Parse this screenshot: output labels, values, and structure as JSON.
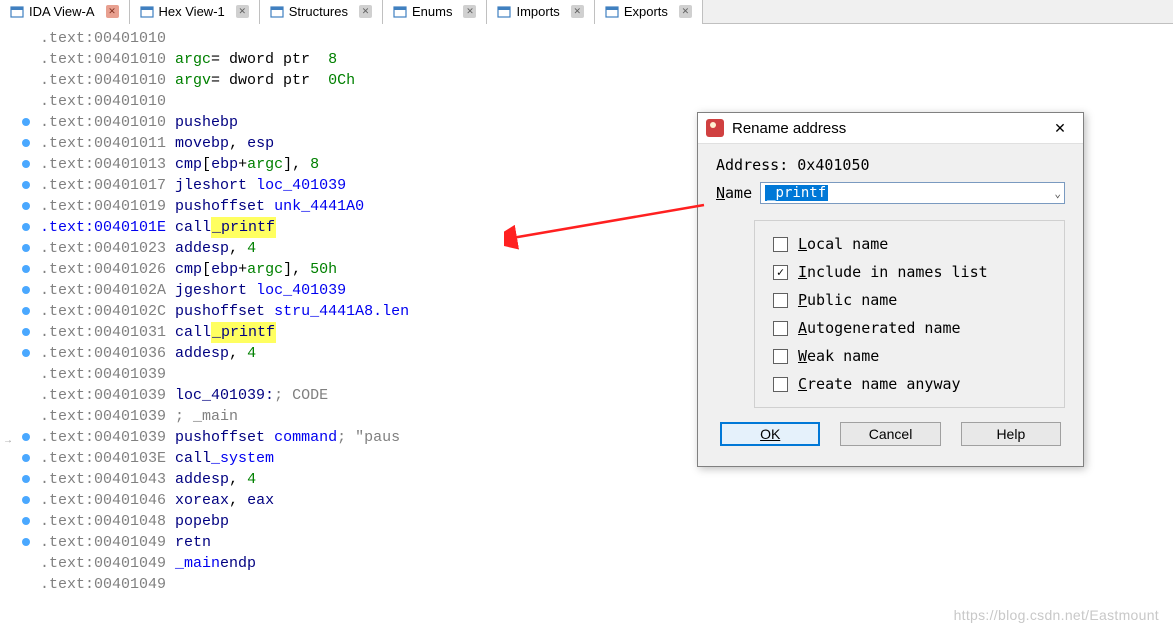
{
  "tabs": [
    {
      "label": "IDA View-A",
      "active": true,
      "closeGray": false
    },
    {
      "label": "Hex View-1",
      "active": false,
      "closeGray": true
    },
    {
      "label": "Structures",
      "active": false,
      "closeGray": true
    },
    {
      "label": "Enums",
      "active": false,
      "closeGray": true
    },
    {
      "label": "Imports",
      "active": false,
      "closeGray": true
    },
    {
      "label": "Exports",
      "active": false,
      "closeGray": true
    }
  ],
  "lines": [
    {
      "dot": false,
      "addr": ".text:00401010"
    },
    {
      "dot": false,
      "addr": ".text:00401010",
      "local": "argc",
      "eq": "= dword ptr  ",
      "eqnum": "8"
    },
    {
      "dot": false,
      "addr": ".text:00401010",
      "local": "argv",
      "eq": "= dword ptr  ",
      "eqnum": "0Ch"
    },
    {
      "dot": false,
      "addr": ".text:00401010"
    },
    {
      "dot": true,
      "addr": ".text:00401010",
      "mnem": "push",
      "ops": [
        {
          "t": "reg",
          "v": "ebp"
        }
      ]
    },
    {
      "dot": true,
      "addr": ".text:00401011",
      "mnem": "mov",
      "ops": [
        {
          "t": "reg",
          "v": "ebp"
        },
        {
          "t": "txt",
          "v": ", "
        },
        {
          "t": "reg",
          "v": "esp"
        }
      ]
    },
    {
      "dot": true,
      "addr": ".text:00401013",
      "mnem": "cmp",
      "ops": [
        {
          "t": "txt",
          "v": "["
        },
        {
          "t": "reg",
          "v": "ebp"
        },
        {
          "t": "txt",
          "v": "+"
        },
        {
          "t": "local",
          "v": "argc"
        },
        {
          "t": "txt",
          "v": "], "
        },
        {
          "t": "num",
          "v": "8"
        }
      ]
    },
    {
      "dot": true,
      "addr": ".text:00401017",
      "mnem": "jle",
      "ops": [
        {
          "t": "mnem",
          "v": "short "
        },
        {
          "t": "ident",
          "v": "loc_401039"
        }
      ]
    },
    {
      "dot": true,
      "addr": ".text:00401019",
      "mnem": "push",
      "ops": [
        {
          "t": "mnem",
          "v": "offset "
        },
        {
          "t": "ident",
          "v": "unk_4441A0"
        }
      ]
    },
    {
      "dot": true,
      "addr": ".text:0040101E",
      "addrBlue": true,
      "mnem": "call",
      "ops": [
        {
          "t": "hl",
          "v": "_printf"
        }
      ]
    },
    {
      "dot": true,
      "addr": ".text:00401023",
      "mnem": "add",
      "ops": [
        {
          "t": "reg",
          "v": "esp"
        },
        {
          "t": "txt",
          "v": ", "
        },
        {
          "t": "num",
          "v": "4"
        }
      ]
    },
    {
      "dot": true,
      "addr": ".text:00401026",
      "mnem": "cmp",
      "ops": [
        {
          "t": "txt",
          "v": "["
        },
        {
          "t": "reg",
          "v": "ebp"
        },
        {
          "t": "txt",
          "v": "+"
        },
        {
          "t": "local",
          "v": "argc"
        },
        {
          "t": "txt",
          "v": "], "
        },
        {
          "t": "num",
          "v": "50h"
        }
      ]
    },
    {
      "dot": true,
      "addr": ".text:0040102A",
      "mnem": "jge",
      "ops": [
        {
          "t": "mnem",
          "v": "short "
        },
        {
          "t": "ident",
          "v": "loc_401039"
        }
      ]
    },
    {
      "dot": true,
      "addr": ".text:0040102C",
      "mnem": "push",
      "ops": [
        {
          "t": "mnem",
          "v": "offset "
        },
        {
          "t": "ident",
          "v": "stru_4441A8.len"
        }
      ]
    },
    {
      "dot": true,
      "addr": ".text:00401031",
      "mnem": "call",
      "ops": [
        {
          "t": "hl",
          "v": "_printf"
        }
      ]
    },
    {
      "dot": true,
      "addr": ".text:00401036",
      "mnem": "add",
      "ops": [
        {
          "t": "reg",
          "v": "esp"
        },
        {
          "t": "txt",
          "v": ", "
        },
        {
          "t": "num",
          "v": "4"
        }
      ]
    },
    {
      "dot": false,
      "addr": ".text:00401039"
    },
    {
      "dot": false,
      "addr": ".text:00401039",
      "label": "loc_401039:",
      "comment": "; CODE "
    },
    {
      "dot": false,
      "addr": ".text:00401039",
      "comment": "; _main"
    },
    {
      "dot": true,
      "arrow": true,
      "addr": ".text:00401039",
      "mnem": "push",
      "ops": [
        {
          "t": "mnem",
          "v": "offset "
        },
        {
          "t": "ident",
          "v": "command"
        }
      ],
      "tailComment": "; \"paus"
    },
    {
      "dot": true,
      "addr": ".text:0040103E",
      "mnem": "call",
      "ops": [
        {
          "t": "ident",
          "v": "_system"
        }
      ]
    },
    {
      "dot": true,
      "addr": ".text:00401043",
      "mnem": "add",
      "ops": [
        {
          "t": "reg",
          "v": "esp"
        },
        {
          "t": "txt",
          "v": ", "
        },
        {
          "t": "num",
          "v": "4"
        }
      ]
    },
    {
      "dot": true,
      "addr": ".text:00401046",
      "mnem": "xor",
      "ops": [
        {
          "t": "reg",
          "v": "eax"
        },
        {
          "t": "txt",
          "v": ", "
        },
        {
          "t": "reg",
          "v": "eax"
        }
      ]
    },
    {
      "dot": true,
      "addr": ".text:00401048",
      "mnem": "pop",
      "ops": [
        {
          "t": "reg",
          "v": "ebp"
        }
      ]
    },
    {
      "dot": true,
      "addr": ".text:00401049",
      "mnem": "retn"
    },
    {
      "dot": false,
      "addr": ".text:00401049",
      "local": "_main",
      "endp": "endp"
    },
    {
      "dot": false,
      "addr": ".text:00401049"
    }
  ],
  "dialog": {
    "title": "Rename address",
    "addressLabel": "Address: 0x401050",
    "nameLabel": "Name",
    "nameValue": "_printf",
    "checks": [
      {
        "label": "Local name",
        "checked": false,
        "ul": "L"
      },
      {
        "label": "Include in names list",
        "checked": true,
        "ul": "I"
      },
      {
        "label": "Public name",
        "checked": false,
        "ul": "P"
      },
      {
        "label": "Autogenerated name",
        "checked": false,
        "ul": "A"
      },
      {
        "label": "Weak name",
        "checked": false,
        "ul": "W"
      },
      {
        "label": "Create name anyway",
        "checked": false,
        "ul": "C"
      }
    ],
    "buttons": {
      "ok": "OK",
      "cancel": "Cancel",
      "help": "Help"
    }
  },
  "watermark": "https://blog.csdn.net/Eastmount"
}
